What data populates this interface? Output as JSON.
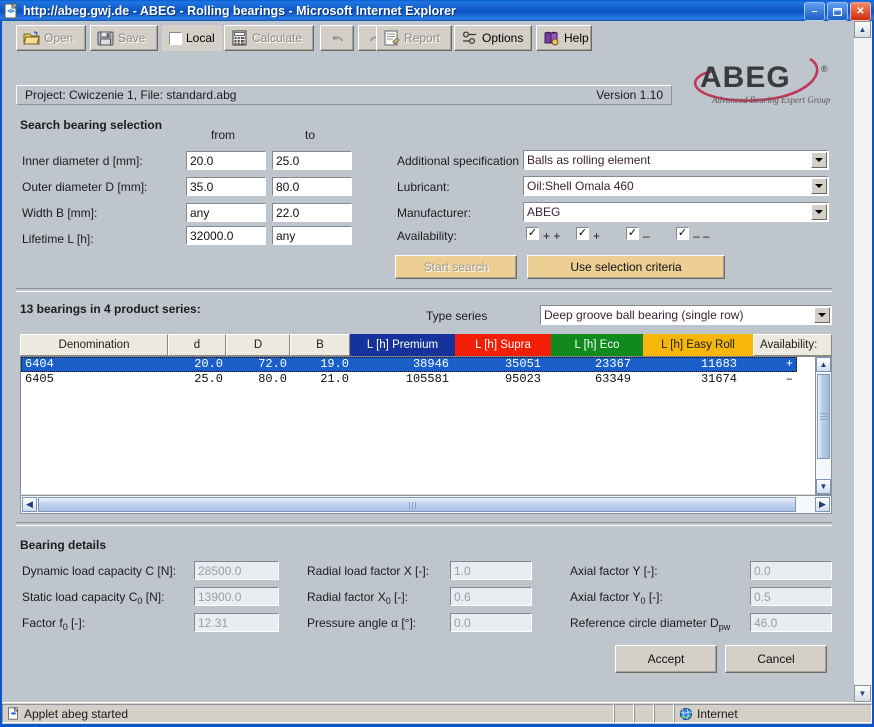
{
  "window": {
    "title": "http://abeg.gwj.de - ABEG - Rolling bearings - Microsoft Internet Explorer",
    "icon": "ie-page-icon",
    "minimize_label": "–",
    "maximize_label": "❐",
    "close_label": "✕"
  },
  "toolbar": {
    "items": [
      {
        "label": "Open",
        "icon": "open-folder-icon",
        "disabled": true,
        "name": "open-button"
      },
      {
        "label": "Save",
        "icon": "floppy-disk-icon",
        "disabled": true,
        "name": "save-button"
      },
      {
        "label": "Local",
        "icon": "checkbox-icon",
        "disabled": false,
        "name": "local-checkbox"
      },
      {
        "label": "Calculate",
        "icon": "calculator-icon",
        "disabled": true,
        "name": "calculate-button"
      },
      {
        "label": "",
        "icon": "undo-icon",
        "disabled": true,
        "name": "undo-button"
      },
      {
        "label": "",
        "icon": "redo-icon",
        "disabled": true,
        "name": "redo-button"
      },
      {
        "label": "Report",
        "icon": "report-icon",
        "disabled": true,
        "name": "report-button"
      },
      {
        "label": "Options",
        "icon": "options-icon",
        "disabled": false,
        "name": "options-button"
      },
      {
        "label": "Help",
        "icon": "help-book-icon",
        "disabled": false,
        "name": "help-button"
      }
    ]
  },
  "project_bar": {
    "project_text": "Project: Cwiczenie 1,  File: standard.abg",
    "version_text": "Version  1.10"
  },
  "logo": {
    "text": "ABEG",
    "registered": "®",
    "tagline": "Advanced Bearing Expert Group",
    "accent_color": "#c0395a"
  },
  "search": {
    "heading": "Search bearing selection",
    "col_from": "from",
    "col_to": "to",
    "rows": [
      {
        "label": "Inner diameter d [mm]:",
        "from": "20.0",
        "to": "25.0"
      },
      {
        "label": "Outer diameter D [mm]:",
        "from": "35.0",
        "to": "80.0"
      },
      {
        "label": "Width B [mm]:",
        "from": "any",
        "to": "22.0"
      },
      {
        "label": "Lifetime L [h]:",
        "from": "32000.0",
        "to": "any"
      }
    ],
    "additional_spec_label": "Additional specification",
    "additional_spec_value": "Balls as rolling element",
    "lubricant_label": "Lubricant:",
    "lubricant_value": "Oil:Shell Omala 460",
    "manufacturer_label": "Manufacturer:",
    "manufacturer_value": "ABEG",
    "availability_label": "Availability:",
    "availability_options": [
      {
        "label": "+ +",
        "checked": true
      },
      {
        "label": "+",
        "checked": true
      },
      {
        "label": "–",
        "checked": true
      },
      {
        "label": "– –",
        "checked": true
      }
    ],
    "start_search_label": "Start search",
    "start_search_disabled": true,
    "use_criteria_label": "Use selection criteria",
    "button_color": "#edcf94"
  },
  "results": {
    "count_text": "13 bearings in 4 product series:",
    "type_series_label": "Type series",
    "type_series_value": "Deep groove ball bearing (single row)",
    "columns": [
      {
        "key": "denomination",
        "label": "Denomination",
        "color": "#ece9e0",
        "text_color": "#1c1c1c"
      },
      {
        "key": "d",
        "label": "d",
        "color": "#ece9e0",
        "text_color": "#1c1c1c"
      },
      {
        "key": "D",
        "label": "D",
        "color": "#ece9e0",
        "text_color": "#1c1c1c"
      },
      {
        "key": "B",
        "label": "B",
        "color": "#ece9e0",
        "text_color": "#1c1c1c"
      },
      {
        "key": "premium",
        "label": "L [h] Premium",
        "color": "#16339c",
        "text_color": "#ffffff"
      },
      {
        "key": "supra",
        "label": "L [h] Supra",
        "color": "#f21f06",
        "text_color": "#ffffff"
      },
      {
        "key": "eco",
        "label": "L [h] Eco",
        "color": "#108a1c",
        "text_color": "#ffffff"
      },
      {
        "key": "easyroll",
        "label": "L [h] Easy Roll",
        "color": "#f6b60a",
        "text_color": "#1c1c1c"
      },
      {
        "key": "availability",
        "label": "Availability:",
        "color": "#ece9e0",
        "text_color": "#1c1c1c"
      }
    ],
    "rows": [
      {
        "denomination": "6404",
        "d": "20.0",
        "D": "72.0",
        "B": "19.0",
        "premium": "38946",
        "supra": "35051",
        "eco": "23367",
        "easyroll": "11683",
        "availability": "+",
        "selected": true
      },
      {
        "denomination": "6405",
        "d": "25.0",
        "D": "80.0",
        "B": "21.0",
        "premium": "105581",
        "supra": "95023",
        "eco": "63349",
        "easyroll": "31674",
        "availability": "–",
        "selected": false
      }
    ],
    "selection_color": "#1a5fc8"
  },
  "details": {
    "heading": "Bearing details",
    "fields": [
      {
        "label_pre": "Dynamic load capacity C [N]:",
        "sub": "",
        "label_post": "",
        "value": "28500.0",
        "name": "dynamic-load-capacity-field"
      },
      {
        "label_pre": "Static load capacity C",
        "sub": "0",
        "label_post": " [N]:",
        "value": "13900.0",
        "name": "static-load-capacity-field"
      },
      {
        "label_pre": "Factor f",
        "sub": "0",
        "label_post": " [-]:",
        "value": "12.31",
        "name": "factor-f0-field"
      },
      {
        "label_pre": "Radial load factor X [-]:",
        "sub": "",
        "label_post": "",
        "value": "1.0",
        "name": "radial-load-factor-x-field"
      },
      {
        "label_pre": "Radial factor X",
        "sub": "0",
        "label_post": " [-]:",
        "value": "0.6",
        "name": "radial-factor-x0-field"
      },
      {
        "label_pre": "Pressure angle α [°]:",
        "sub": "",
        "label_post": "",
        "value": "0.0",
        "name": "pressure-angle-field"
      },
      {
        "label_pre": "Axial factor Y [-]:",
        "sub": "",
        "label_post": "",
        "value": "0.0",
        "name": "axial-factor-y-field"
      },
      {
        "label_pre": "Axial factor Y",
        "sub": "0",
        "label_post": " [-]:",
        "value": "0.5",
        "name": "axial-factor-y0-field"
      },
      {
        "label_pre": "Reference circle diameter D",
        "sub": "pw",
        "label_post": "",
        "value": "46.0",
        "name": "reference-circle-diameter-field"
      }
    ],
    "accept_label": "Accept",
    "cancel_label": "Cancel"
  },
  "statusbar": {
    "message": "Applet abeg started",
    "zone": "Internet",
    "zone_icon": "globe-icon",
    "page_icon": "ie-page-icon"
  }
}
